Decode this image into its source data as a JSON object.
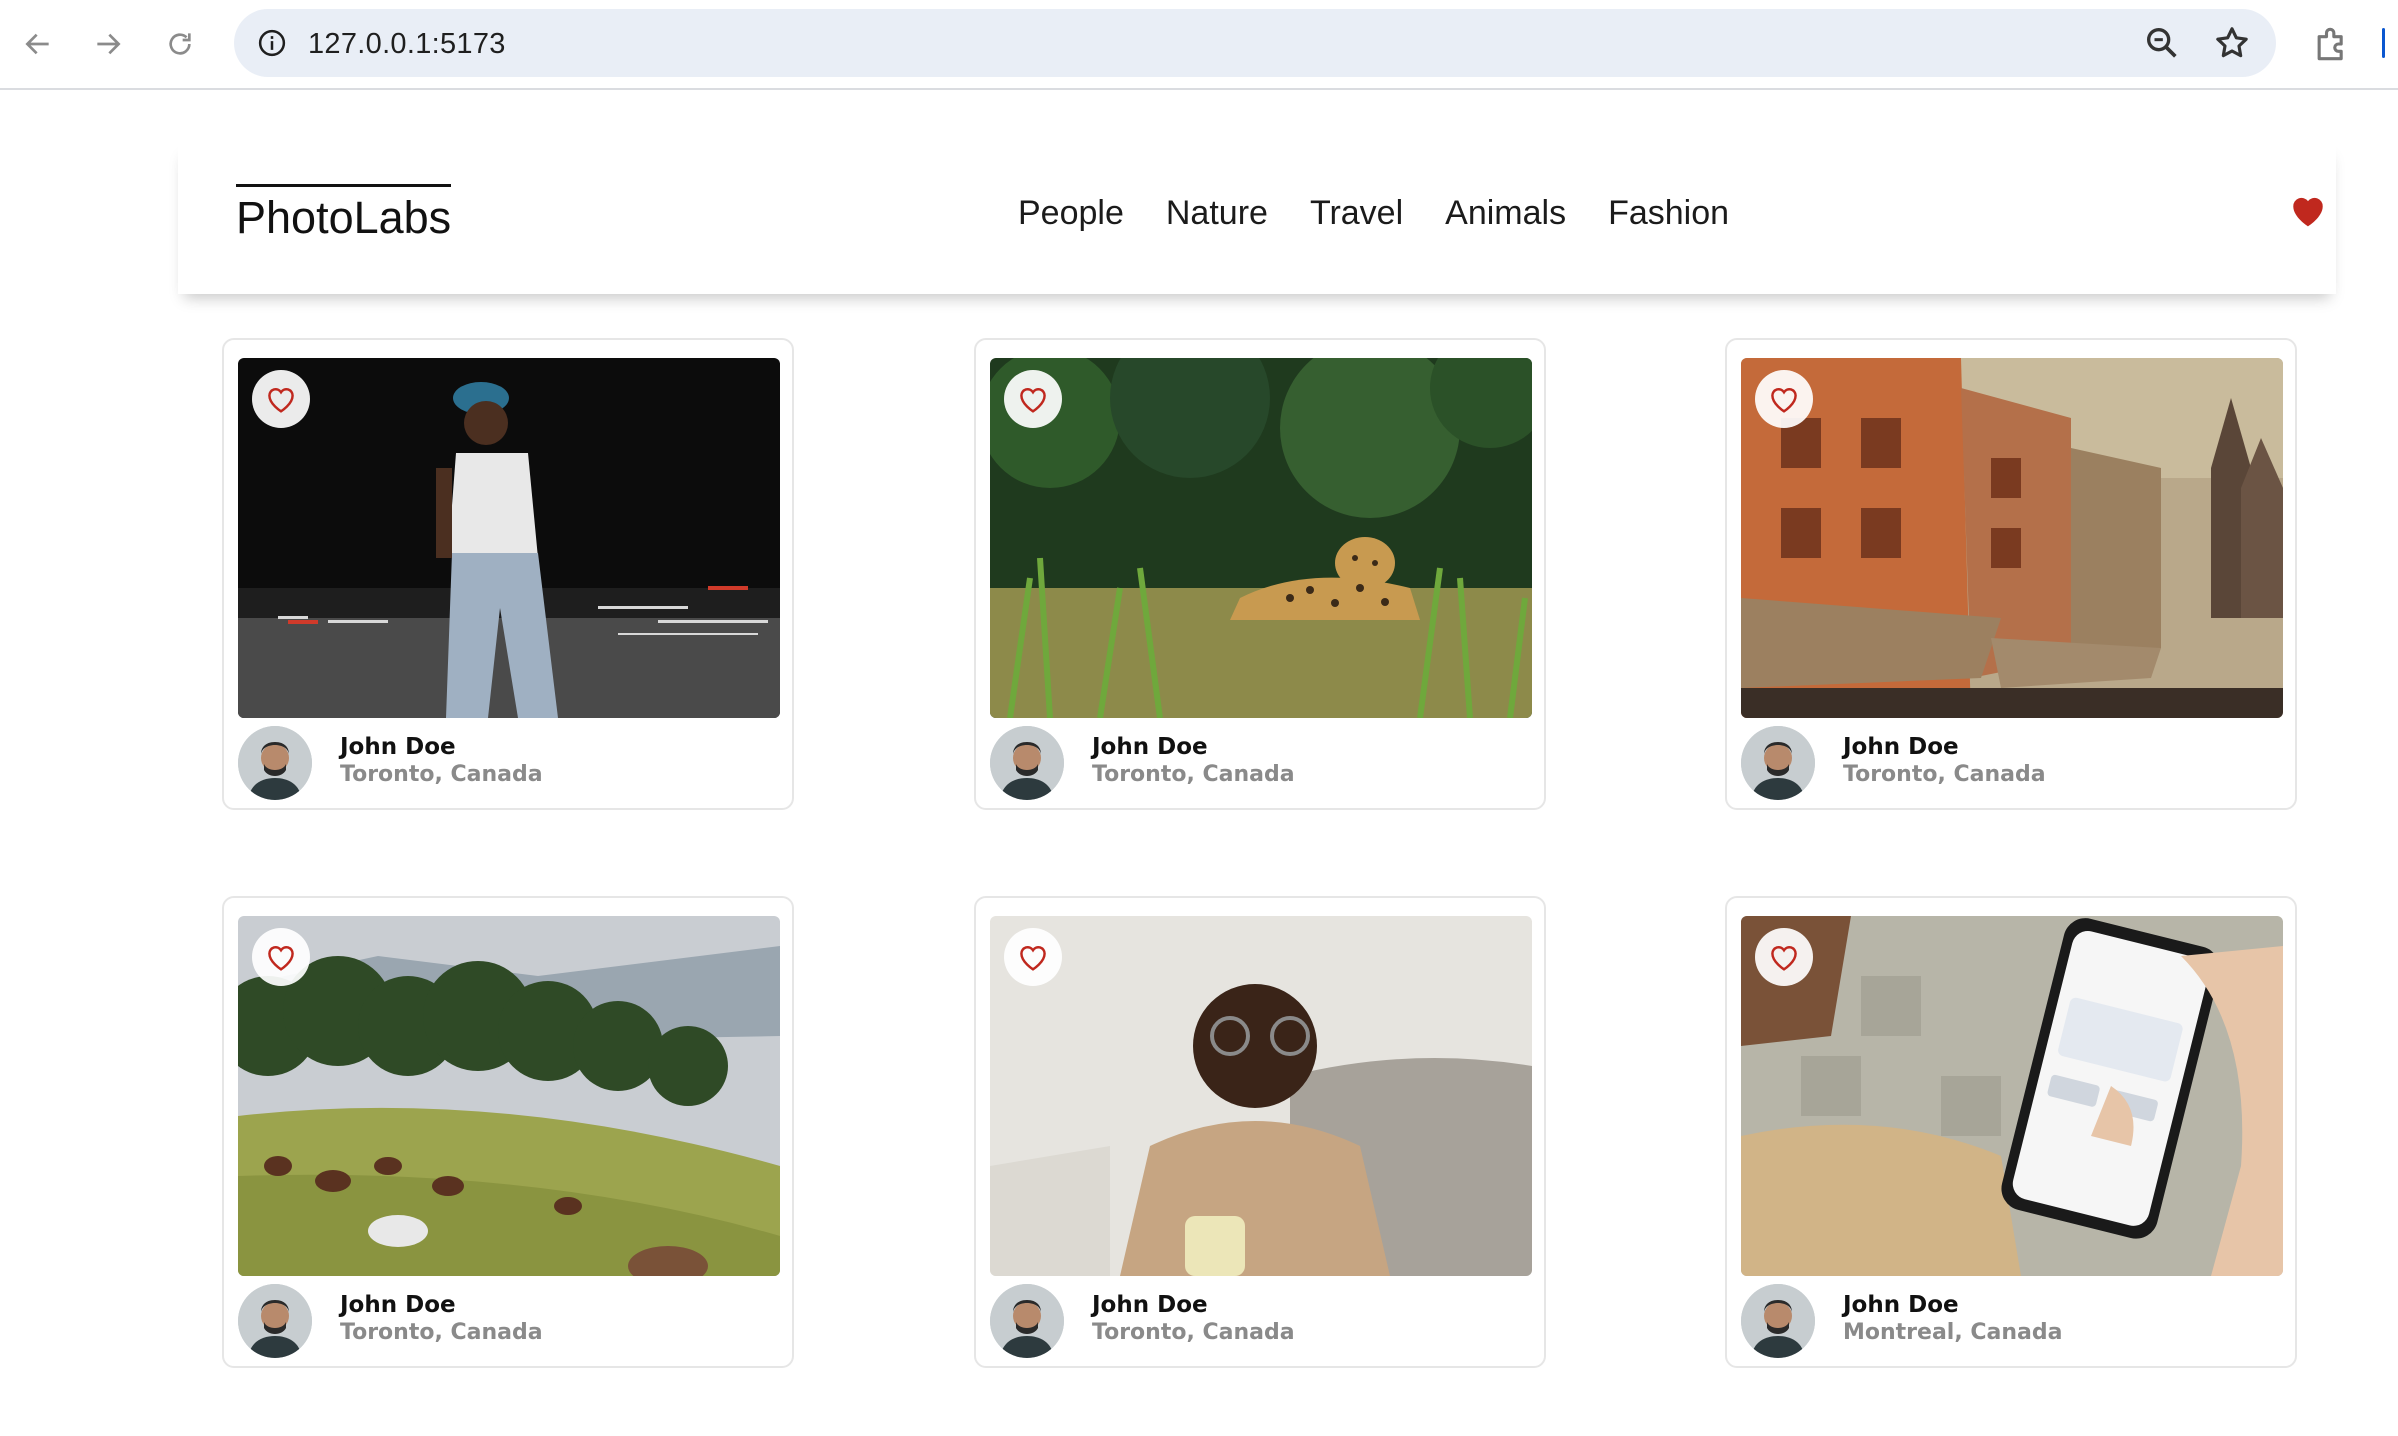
{
  "browser": {
    "url": "127.0.0.1:5173",
    "icons": [
      "back-icon",
      "forward-icon",
      "reload-icon",
      "site-info-icon",
      "zoom-icon",
      "bookmark-star-icon",
      "extensions-icon"
    ]
  },
  "app": {
    "logo": "PhotoLabs",
    "topics": [
      "People",
      "Nature",
      "Travel",
      "Animals",
      "Fashion"
    ],
    "accent_color": "#c0281e"
  },
  "photos": [
    {
      "user": "John Doe",
      "location": "Toronto, Canada",
      "scene": "man-walking-night",
      "liked": false
    },
    {
      "user": "John Doe",
      "location": "Toronto, Canada",
      "scene": "jaguar-in-grass",
      "liked": false
    },
    {
      "user": "John Doe",
      "location": "Toronto, Canada",
      "scene": "old-town-street",
      "liked": false
    },
    {
      "user": "John Doe",
      "location": "Toronto, Canada",
      "scene": "horses-on-hill",
      "liked": false
    },
    {
      "user": "John Doe",
      "location": "Toronto, Canada",
      "scene": "smiling-man-coffee",
      "liked": false
    },
    {
      "user": "John Doe",
      "location": "Montreal, Canada",
      "scene": "hand-holding-phone",
      "liked": false
    }
  ]
}
